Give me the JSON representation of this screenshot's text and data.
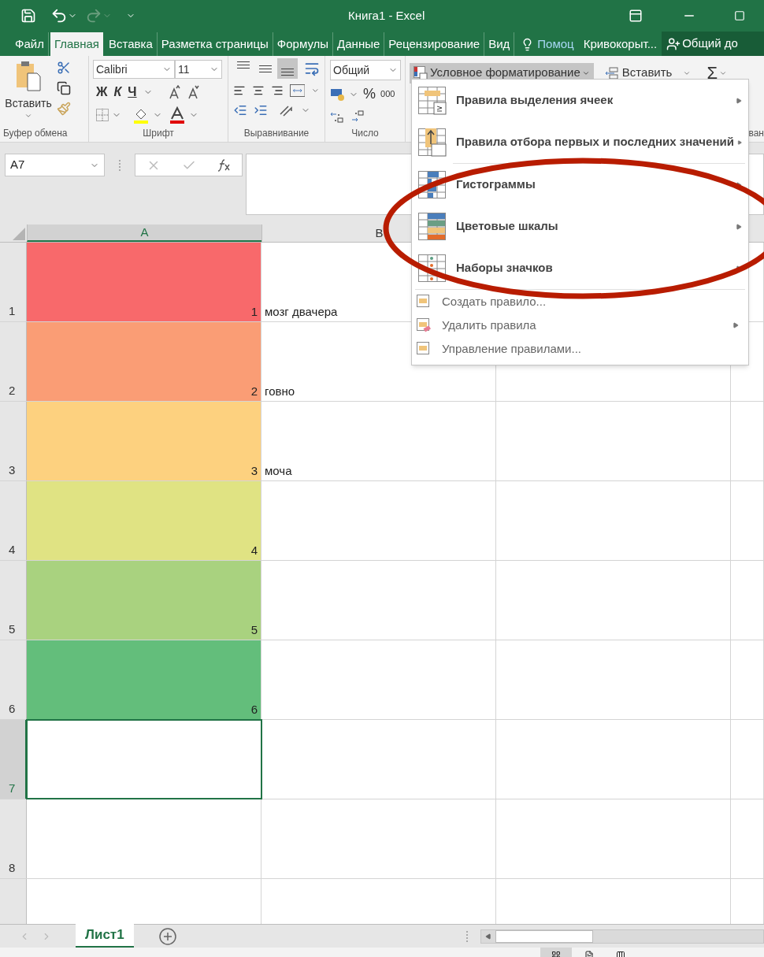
{
  "window": {
    "title": "Книга1 - Excel"
  },
  "tabs": [
    {
      "label": "Файл",
      "selected": false
    },
    {
      "label": "Главная",
      "selected": true
    },
    {
      "label": "Вставка",
      "selected": false
    },
    {
      "label": "Разметка страницы",
      "selected": false
    },
    {
      "label": "Формулы",
      "selected": false
    },
    {
      "label": "Данные",
      "selected": false
    },
    {
      "label": "Рецензирование",
      "selected": false
    },
    {
      "label": "Вид",
      "selected": false
    }
  ],
  "tell_me": "Помоц",
  "user": "Кривокорыт...",
  "share": "Общий до",
  "ribbon": {
    "paste": "Вставить",
    "clipboard_label": "Буфер обмена",
    "font_name": "Calibri",
    "font_size": "11",
    "bold": "Ж",
    "italic": "К",
    "underline": "Ч",
    "font_label": "Шрифт",
    "vertical_align": [
      {
        "selected": false
      },
      {
        "selected": false
      },
      {
        "selected": true
      }
    ],
    "alignment_label": "Выравнивание",
    "number_format": "Общий",
    "percent": "%",
    "thousands": "000",
    "number_label": "Число",
    "conditional_formatting": "Условное форматирование",
    "insert": "Вставить",
    "sum": "Σ",
    "cut_label": "ван"
  },
  "name_box": "A7",
  "columns": [
    {
      "label": "A",
      "selected": true
    },
    {
      "label": "B",
      "selected": false
    }
  ],
  "rows": [
    {
      "number": "1",
      "selected": false,
      "cells": [
        {
          "value": "1",
          "color": "#f8696b"
        },
        {
          "value": "мозг двачера"
        }
      ]
    },
    {
      "number": "2",
      "selected": false,
      "cells": [
        {
          "value": "2",
          "color": "#fa9d75"
        },
        {
          "value": "говно"
        }
      ]
    },
    {
      "number": "3",
      "selected": false,
      "cells": [
        {
          "value": "3",
          "color": "#fdd17f"
        },
        {
          "value": "моча"
        }
      ]
    },
    {
      "number": "4",
      "selected": false,
      "cells": [
        {
          "value": "4",
          "color": "#e0e383"
        }
      ]
    },
    {
      "number": "5",
      "selected": false,
      "cells": [
        {
          "value": "5",
          "color": "#a9d27f"
        }
      ]
    },
    {
      "number": "6",
      "selected": false,
      "cells": [
        {
          "value": "6",
          "color": "#63be7b"
        }
      ]
    },
    {
      "number": "7",
      "selected": true,
      "cells": []
    },
    {
      "number": "8",
      "selected": false,
      "cells": []
    }
  ],
  "sheets": [
    {
      "label": "Лист1",
      "selected": true
    }
  ],
  "menu": [
    {
      "kind": "large",
      "label": "Правила выделения ячеек",
      "submenu": true
    },
    {
      "kind": "large",
      "label": "Правила отбора первых и последних значений",
      "submenu": true
    },
    {
      "kind": "large",
      "label": "Гистограммы",
      "submenu": true
    },
    {
      "kind": "large",
      "label": "Цветовые шкалы",
      "submenu": true
    },
    {
      "kind": "large",
      "label": "Наборы значков",
      "submenu": true
    },
    {
      "kind": "small",
      "label": "Создать правило...",
      "submenu": false
    },
    {
      "kind": "small",
      "label": "Удалить правила",
      "submenu": true
    },
    {
      "kind": "small",
      "label": "Управление правилами...",
      "submenu": false
    }
  ]
}
